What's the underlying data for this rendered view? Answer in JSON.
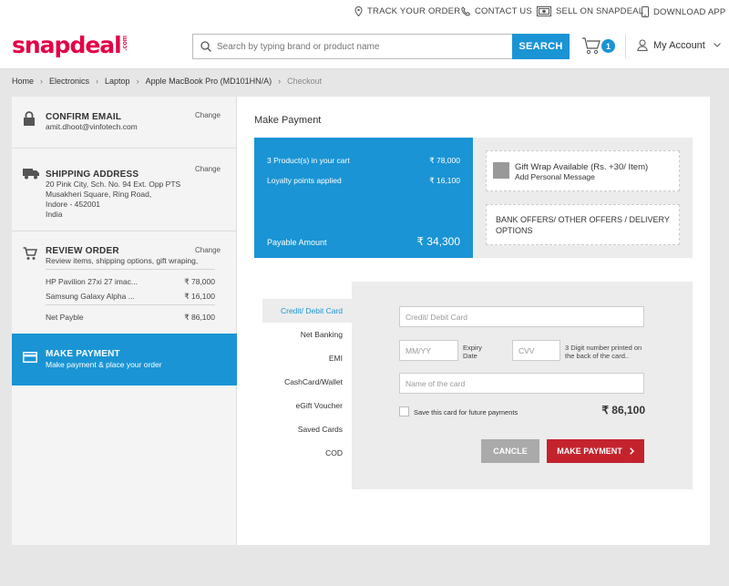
{
  "top_links": {
    "track": "TRACK YOUR ORDER",
    "contact": "CONTACT US",
    "sell": "SELL ON SNAPDEAL",
    "download": "DOWNLOAD APP"
  },
  "header": {
    "logo": "snapdeal",
    "logo_suffix": ".com",
    "search_placeholder": "Search by typing brand or product name",
    "search_button": "SEARCH",
    "cart_count": "1",
    "account_label": "My Account"
  },
  "breadcrumb": [
    "Home",
    "Electronics",
    "Laptop",
    "Apple MacBook Pro (MD101HN/A)",
    "Checkout"
  ],
  "steps": {
    "confirm_email": {
      "title": "CONFIRM EMAIL",
      "value": "amit.dhoot@vinfotech.com",
      "change": "Change"
    },
    "shipping": {
      "title": "SHIPPING ADDRESS",
      "lines": [
        "20 Pink City,  Sch. No. 94 Ext. Opp PTS",
        "Musakheri Square, Ring Road,",
        "Indore - 452001",
        "India"
      ],
      "change": "Change"
    },
    "review": {
      "title": "REVIEW ORDER",
      "sub": "Review items, shipping options, gift wraping,",
      "change": "Change",
      "items": [
        {
          "name": "HP Pavilion 27xi 27 imac...",
          "price": "₹ 78,000"
        },
        {
          "name": "Samsung Galaxy Alpha ...",
          "price": "₹ 16,100"
        }
      ],
      "net_label": "Net Payble",
      "net_value": "₹ 86,100"
    },
    "make_payment": {
      "title": "MAKE PAYMENT",
      "sub": "Make payment & place your order"
    }
  },
  "payment": {
    "heading": "Make Payment",
    "summary": {
      "products_label": "3 Product(s) in your cart",
      "products_value": "₹ 78,000",
      "loyalty_label": "Loyalty points applied",
      "loyalty_value": "₹ 16,100",
      "payable_label": "Payable Amount",
      "payable_value": "₹ 34,300"
    },
    "gift_title": "Gift Wrap Available (Rs. +30/ Item)",
    "gift_sub": "Add Personal Message",
    "offers": "BANK OFFERS/ OTHER OFFERS / DELIVERY OPTIONS",
    "methods": [
      "Credit/ Debit Card",
      "Net Banking",
      "EMI",
      "CashCard/Wallet",
      "eGift Voucher",
      "Saved Cards",
      "COD"
    ],
    "form": {
      "card_placeholder": "Credit/ Debit Card",
      "expiry_placeholder": "MM/YY",
      "expiry_label": "Expiry Date",
      "cvv_placeholder": "CVV",
      "cvv_label": "3 Digit number printed on the back of the card..",
      "name_placeholder": "Name of the card",
      "save_label": "Save this card for future payments",
      "total": "₹ 86,100",
      "cancel": "CANCLE",
      "pay": "MAKE PAYMENT"
    }
  },
  "colors": {
    "brand": "#e40046",
    "accent": "#1a94d4",
    "pay_button": "#c4232e"
  }
}
